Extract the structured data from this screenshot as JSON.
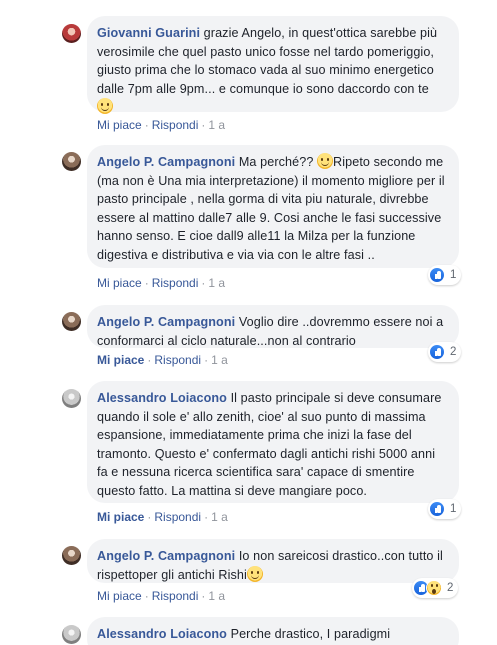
{
  "comments": [
    {
      "author": "Giovanni Guarini",
      "text": " grazie Angelo, in quest'ottica sarebbe più verosimile che quel pasto unico fosse nel tardo pomeriggio, giusto prima che lo stomaco vada al suo minimo energetico dalle 7pm alle 9pm... e comunque io sono daccordo con te ",
      "emoji": "smile-emoji",
      "like_label": "Mi piace",
      "reply_label": "Rispondi",
      "time": "1 a"
    },
    {
      "author": "Angelo P. Campagnoni",
      "text_before": " Ma perché?? ",
      "emoji": "smile-emoji",
      "text_after": "Ripeto secondo me (ma non è Una mia interpretazione) il momento migliore per il pasto principale , nella gorma di vita piu naturale, divrebbe essere al mattino dalle7 alle 9. Cosi anche le fasi successive hanno senso. E cioe dall9 alle11 la Milza per la funzione digestiva e distributiva e via via con le altre fasi ..",
      "like_label": "Mi piace",
      "reply_label": "Rispondi",
      "time": "1 a",
      "reactions": {
        "types": [
          "like"
        ],
        "count": "1"
      }
    },
    {
      "author": "Angelo P. Campagnoni",
      "text": " Voglio dire ..dovremmo essere noi a conformarci al ciclo naturale...non al contrario",
      "like_label": "Mi piace",
      "reply_label": "Rispondi",
      "time": "1 a",
      "reactions": {
        "types": [
          "like"
        ],
        "count": "2"
      }
    },
    {
      "author": "Alessandro Loiacono",
      "text": " Il pasto principale si deve consumare quando il sole e' allo zenith, cioe' al suo punto di massima espansione, immediatamente prima che inizi la fase del tramonto. Questo e' confermato dagli antichi rishi 5000 anni fa e nessuna ricerca scientifica sara' capace di smentire questo fatto. La mattina si deve mangiare poco.",
      "like_label": "Mi piace",
      "reply_label": "Rispondi",
      "time": "1 a",
      "reactions": {
        "types": [
          "like"
        ],
        "count": "1"
      }
    },
    {
      "author": "Angelo P. Campagnoni",
      "text": " Io non sareicosi drastico..con tutto il rispettoper gli antichi Rishi",
      "emoji": "smile-emoji",
      "like_label": "Mi piace",
      "reply_label": "Rispondi",
      "time": "1 a",
      "reactions": {
        "types": [
          "like",
          "wow"
        ],
        "count": "2"
      }
    },
    {
      "author": "Alessandro Loiacono",
      "text": " Perche drastico, I paradigmi"
    }
  ],
  "separator": "·"
}
